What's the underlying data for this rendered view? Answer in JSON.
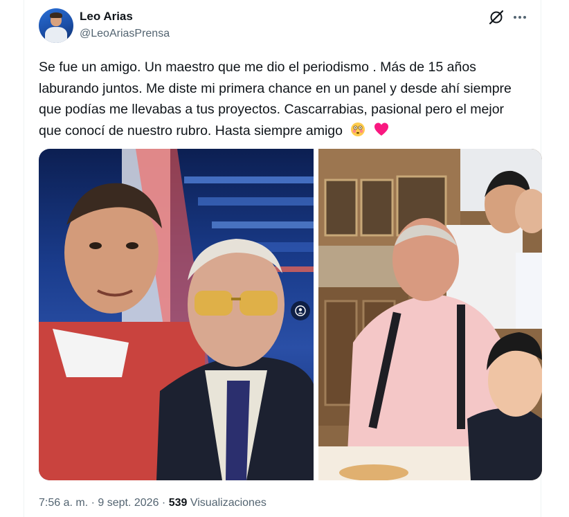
{
  "author": {
    "name": "Leo Arias",
    "handle": "@LeoAriasPrensa"
  },
  "post": {
    "text": "Se fue un amigo. Un maestro que me dio el periodismo . Más de 15 años laburando juntos. Me diste mi primera chance en un panel y desde ahí siempre que podías me llevabas a tus proyectos. Cascarrabias, pasional pero el mejor que conocí de nuestro rubro. Hasta siempre amigo",
    "emojis": [
      "flushed-face",
      "red-heart"
    ]
  },
  "meta": {
    "time": "7:56 a. m.",
    "separator": "·",
    "date": "9 sept. 2026",
    "views_count": "539",
    "views_label": "Visualizaciones"
  },
  "icons": {
    "grok": "grok-icon",
    "more": "more-icon",
    "alt": "person-icon"
  },
  "colors": {
    "text": "#0f1419",
    "secondary": "#536471",
    "heart": "#f91880"
  }
}
